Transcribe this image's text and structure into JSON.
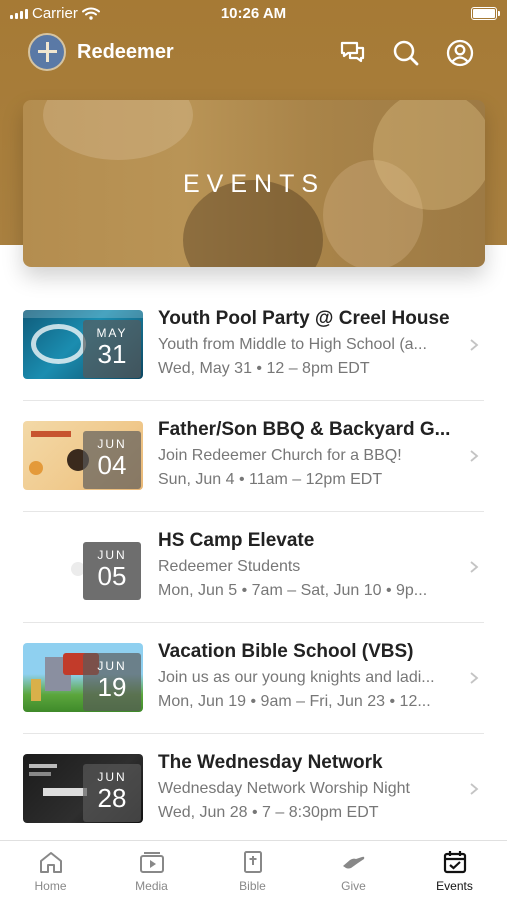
{
  "status_bar": {
    "carrier": "Carrier",
    "time": "10:26 AM"
  },
  "app_bar": {
    "title": "Redeemer"
  },
  "hero": {
    "title": "EVENTS"
  },
  "events": [
    {
      "title": "Youth Pool Party @ Creel House",
      "subtitle": "Youth from Middle to High School (a...",
      "time": "Wed, May 31 • 12 – 8pm EDT",
      "month": "MAY",
      "day": "31"
    },
    {
      "title": "Father/Son BBQ & Backyard G...",
      "subtitle": "Join Redeemer Church for a BBQ!",
      "time": "Sun, Jun 4 • 11am – 12pm EDT",
      "month": "JUN",
      "day": "04"
    },
    {
      "title": "HS Camp Elevate",
      "subtitle": "Redeemer Students",
      "time": "Mon, Jun 5 • 7am – Sat, Jun 10 • 9p...",
      "month": "JUN",
      "day": "05"
    },
    {
      "title": "Vacation Bible School (VBS)",
      "subtitle": "Join us as our young knights and ladi...",
      "time": "Mon, Jun 19 • 9am – Fri, Jun 23 • 12...",
      "month": "JUN",
      "day": "19"
    },
    {
      "title": "The Wednesday Network",
      "subtitle": "Wednesday Network Worship Night",
      "time": "Wed, Jun 28 • 7 – 8:30pm EDT",
      "month": "JUN",
      "day": "28"
    }
  ],
  "tabs": [
    {
      "label": "Home",
      "icon": "home-icon"
    },
    {
      "label": "Media",
      "icon": "media-icon"
    },
    {
      "label": "Bible",
      "icon": "bible-icon"
    },
    {
      "label": "Give",
      "icon": "give-icon"
    },
    {
      "label": "Events",
      "icon": "calendar-icon",
      "active": true
    }
  ],
  "colors": {
    "brand": "#a67a35",
    "active_tab": "#111111",
    "inactive_tab": "#888888"
  }
}
